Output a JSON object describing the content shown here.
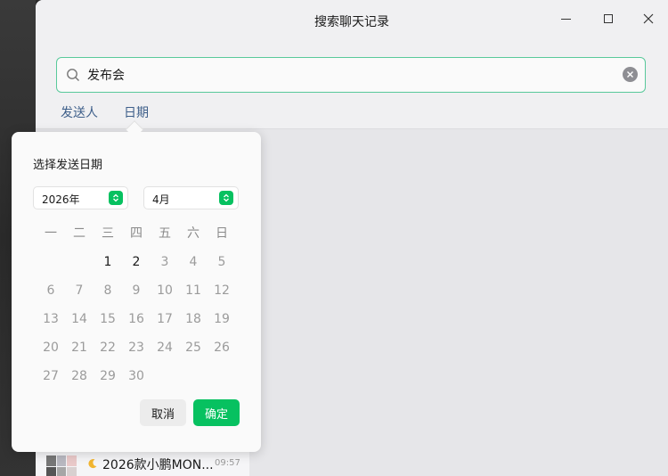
{
  "window": {
    "title": "搜索聊天记录"
  },
  "search": {
    "query": "发布会"
  },
  "filters": {
    "sender": "发送人",
    "date": "日期"
  },
  "date_picker": {
    "title": "选择发送日期",
    "year": "2026年",
    "month": "4月",
    "weekdays": [
      "一",
      "二",
      "三",
      "四",
      "五",
      "六",
      "日"
    ],
    "weeks": [
      [
        "",
        "",
        "1",
        "2",
        "3",
        "4",
        "5"
      ],
      [
        "6",
        "7",
        "8",
        "9",
        "10",
        "11",
        "12"
      ],
      [
        "13",
        "14",
        "15",
        "16",
        "17",
        "18",
        "19"
      ],
      [
        "20",
        "21",
        "22",
        "23",
        "24",
        "25",
        "26"
      ],
      [
        "27",
        "28",
        "29",
        "30",
        "",
        "",
        ""
      ]
    ],
    "active_days": [
      "1",
      "2"
    ],
    "cancel_label": "取消",
    "confirm_label": "确定"
  },
  "result": {
    "text": "2026款小鹏MON...",
    "time": "09:57"
  },
  "colors": {
    "accent": "#07c160",
    "search_border": "#59c99b",
    "link": "#3e5f8a"
  }
}
